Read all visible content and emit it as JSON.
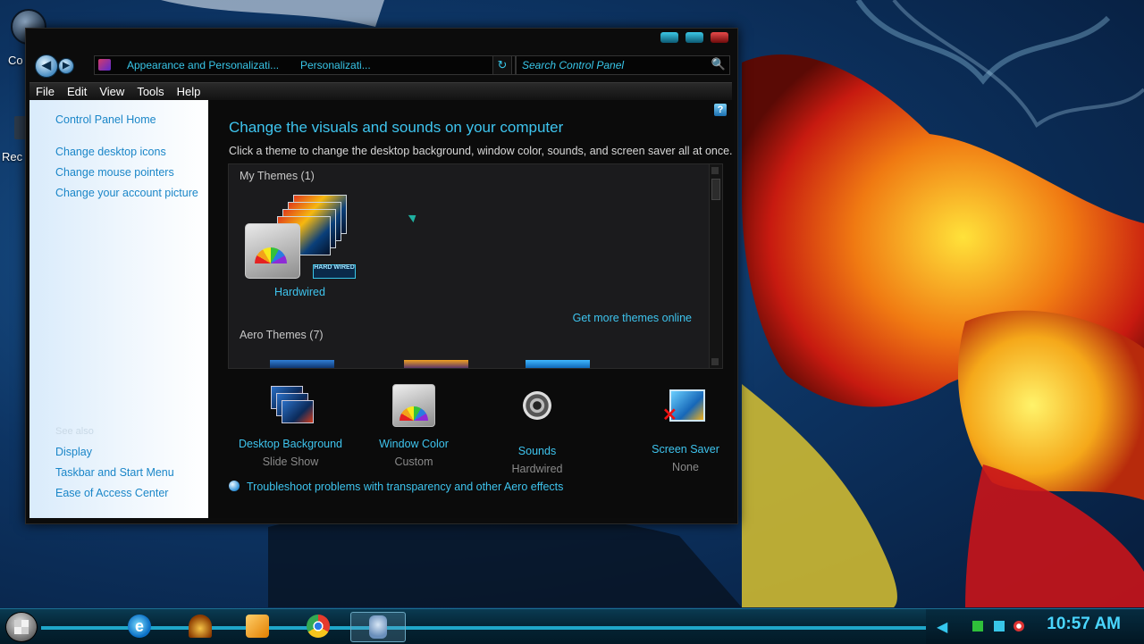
{
  "desktop": {
    "icons": [
      {
        "label": "Co",
        "icon": "computer-icon"
      },
      {
        "label": "Rec",
        "icon": "recycle-bin-icon"
      }
    ]
  },
  "window": {
    "breadcrumb": [
      "Appearance and Personalizati...",
      "Personalizati..."
    ],
    "search_placeholder": "Search Control Panel",
    "menu": [
      "File",
      "Edit",
      "View",
      "Tools",
      "Help"
    ],
    "sidebar": {
      "home": "Control Panel Home",
      "tasks": [
        "Change desktop icons",
        "Change mouse pointers",
        "Change your account picture"
      ],
      "see_also_label": "See also",
      "see_also": [
        "Display",
        "Taskbar and Start Menu",
        "Ease of Access Center"
      ]
    },
    "main": {
      "title": "Change the visuals and sounds on your computer",
      "subtitle": "Click a theme to change the desktop background, window color, sounds, and screen saver all at once.",
      "my_themes_label": "My Themes (1)",
      "theme_name": "Hardwired",
      "theme_badge": "HARD WIRED",
      "more_themes": "Get more themes online",
      "aero_themes_label": "Aero Themes (7)",
      "options": [
        {
          "label": "Desktop Background",
          "value": "Slide Show",
          "icon": "desktop-background-icon"
        },
        {
          "label": "Window Color",
          "value": "Custom",
          "icon": "window-color-icon"
        },
        {
          "label": "Sounds",
          "value": "Hardwired",
          "icon": "sounds-icon"
        },
        {
          "label": "Screen Saver",
          "value": "None",
          "icon": "screen-saver-icon"
        }
      ],
      "troubleshoot": "Troubleshoot problems with transparency and other Aero effects"
    }
  },
  "taskbar": {
    "clock": "10:57 AM",
    "apps": [
      "internet-explorer-icon",
      "monitor-app-icon",
      "media-player-icon",
      "chrome-icon",
      "control-panel-icon"
    ]
  },
  "colors": {
    "accent": "#3ec4ee",
    "link": "#1a86c8",
    "window_bg": "#0b0b0b"
  }
}
